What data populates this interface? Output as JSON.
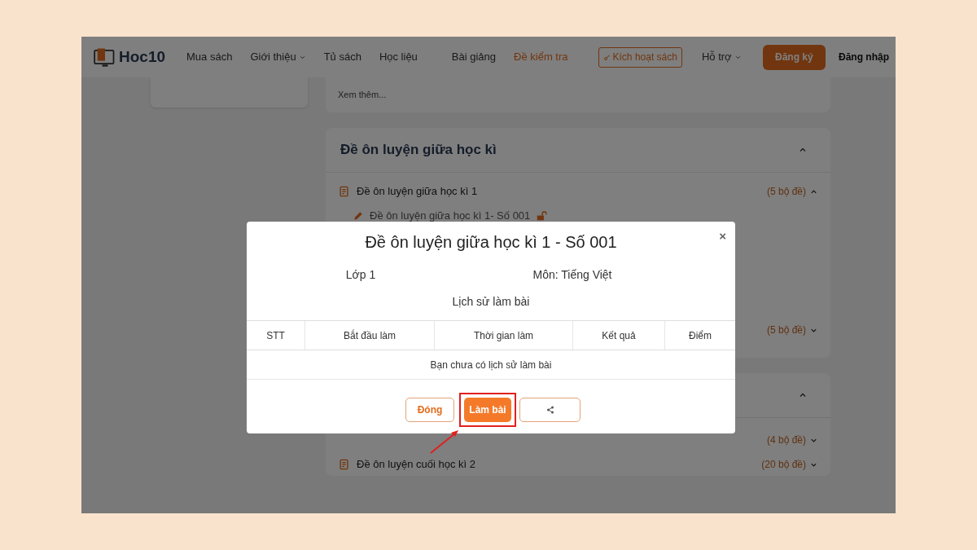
{
  "nav": {
    "logo_text": "Hoc10",
    "items": [
      {
        "label": "Mua sách",
        "selected": false,
        "has_menu": false
      },
      {
        "label": "Giới thiệu",
        "selected": false,
        "has_menu": true
      },
      {
        "label": "Tủ sách",
        "selected": false,
        "has_menu": false
      },
      {
        "label": "Học liệu",
        "selected": false,
        "has_menu": false
      },
      {
        "label": "Bài giảng",
        "selected": false,
        "has_menu": false
      },
      {
        "label": "Đề kiểm tra",
        "selected": true,
        "has_menu": false
      }
    ],
    "activate_button": "Kích hoạt sách",
    "support": "Hỗ trợ",
    "register_button": "Đăng ký",
    "login_link": "Đăng nhập"
  },
  "more_link": "Xem thêm...",
  "sections": [
    {
      "title": "Đề ôn luyện giữa học kì",
      "expanded": true,
      "items": [
        {
          "label": "Đề ôn luyện giữa học kì 1",
          "count": "(5 bộ đề)",
          "expanded": true,
          "children": [
            {
              "label": "Đề ôn luyện giữa học kì 1- Số 001",
              "locked": false
            }
          ]
        },
        {
          "count": "(5 bộ đề)",
          "expanded": false
        }
      ]
    },
    {
      "expanded": true,
      "items": [
        {
          "count": "(4 bộ đề)",
          "expanded": false
        },
        {
          "label": "Đề ôn luyện cuối học kì 2",
          "count": "(20 bộ đề)",
          "expanded": false
        }
      ]
    }
  ],
  "modal": {
    "title": "Đề ôn luyện giữa học kì 1 - Số 001",
    "grade": "Lớp 1",
    "subject": "Môn: Tiếng Việt",
    "history_title": "Lịch sử làm bài",
    "columns": [
      "STT",
      "Bắt đầu làm",
      "Thời gian làm",
      "Kết quả",
      "Điểm"
    ],
    "empty_message": "Bạn chưa có lịch sử làm bài",
    "close_button": "Đóng",
    "start_button": "Làm bài",
    "close_icon": "×"
  }
}
